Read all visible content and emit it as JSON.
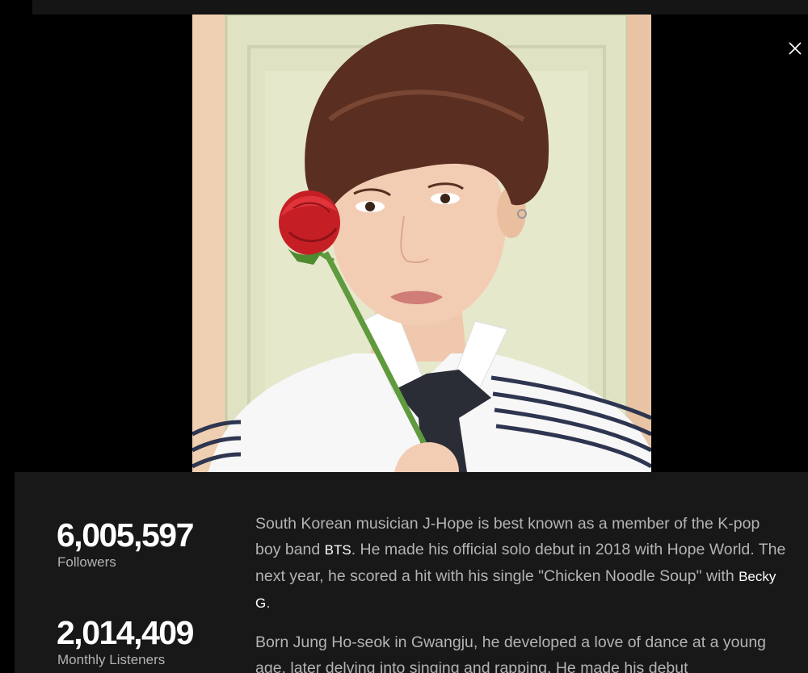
{
  "modal": {
    "close_icon": "close-icon",
    "photo_alt": "J-Hope"
  },
  "stats": {
    "followers": {
      "value": "6,005,597",
      "label": "Followers"
    },
    "monthly_listeners": {
      "value": "2,014,409",
      "label": "Monthly Listeners"
    }
  },
  "bio": {
    "p1": {
      "t1": "South Korean musician J-Hope is best known as a member of the K-pop boy band ",
      "link1": "BTS",
      "t2": ". He made his official solo debut in 2018 with Hope World. The next year, he scored a hit with his single \"Chicken Noodle Soup\" with ",
      "link2": "Becky G",
      "t3": "."
    },
    "p2": "Born Jung Ho-seok in Gwangju, he developed a love of dance at a young age, later delving into singing and rapping. He made his debut"
  },
  "colors": {
    "background": "#000000",
    "panel": "#181818",
    "primary_text": "#ffffff",
    "secondary_text": "#b3b3b3"
  }
}
